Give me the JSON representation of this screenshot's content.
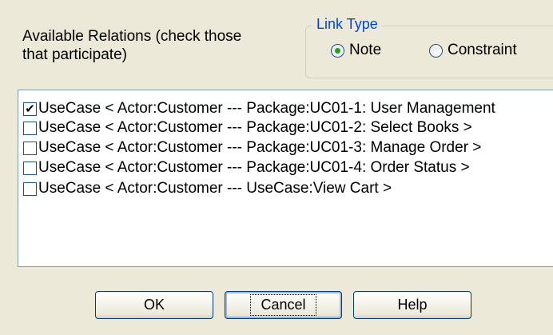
{
  "instructions": "Available Relations (check those that participate)",
  "link_type": {
    "title": "Link Type",
    "options": [
      {
        "label": "Note",
        "selected": true
      },
      {
        "label": "Constraint",
        "selected": false
      }
    ]
  },
  "relations": [
    {
      "label": "UseCase < Actor:Customer --- Package:UC01-1: User Management",
      "checked": true
    },
    {
      "label": "UseCase < Actor:Customer --- Package:UC01-2: Select Books >",
      "checked": false
    },
    {
      "label": "UseCase < Actor:Customer --- Package:UC01-3: Manage Order >",
      "checked": false
    },
    {
      "label": "UseCase < Actor:Customer --- Package:UC01-4: Order Status >",
      "checked": false
    },
    {
      "label": "UseCase < Actor:Customer --- UseCase:View Cart >",
      "checked": false
    }
  ],
  "buttons": {
    "ok": "OK",
    "cancel": "Cancel",
    "help": "Help"
  },
  "colors": {
    "groupbox_title": "#0046d5",
    "radio_selected": "#21a121"
  }
}
